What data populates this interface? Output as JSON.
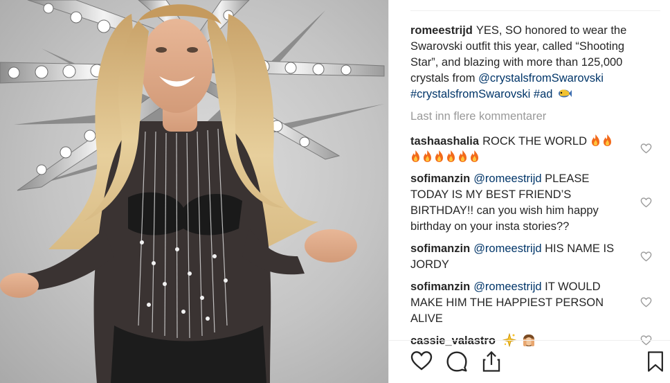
{
  "post": {
    "author": "romeestrijd",
    "caption_parts": [
      {
        "type": "text",
        "value": "YES, SO honored to wear the Swarovski outfit this year, called “Shooting Star”, and blazing with more than 125,000 crystals from "
      },
      {
        "type": "mention",
        "value": "@crystalsfromSwarovski"
      },
      {
        "type": "text",
        "value": " "
      },
      {
        "type": "tag",
        "value": "#crystalsfromSwarovski"
      },
      {
        "type": "text",
        "value": " "
      },
      {
        "type": "tag",
        "value": "#ad"
      }
    ],
    "load_more_label": "Last inn flere kommentarer"
  },
  "comments": [
    {
      "user": "tashaashalia",
      "mention": "",
      "text": "ROCK THE WORLD",
      "fire_count_inline": 2,
      "fire_count_line2": 6
    },
    {
      "user": "sofimanzin",
      "mention": "@romeestrijd",
      "text": "PLEASE TODAY IS MY BEST FRIEND’S BIRTHDAY!! can you wish him happy birthday on your insta stories??"
    },
    {
      "user": "sofimanzin",
      "mention": "@romeestrijd",
      "text": "HIS NAME IS JORDY"
    },
    {
      "user": "sofimanzin",
      "mention": "@romeestrijd",
      "text": "IT WOULD MAKE HIM THE HAPPIEST PERSON ALIVE"
    },
    {
      "user": "cassie_valastro",
      "mention": "",
      "text": ""
    }
  ],
  "icons": {
    "comment_like": "heart-outline-icon",
    "action_like": "heart-icon",
    "action_comment": "speech-bubble-icon",
    "action_share": "share-icon",
    "action_save": "bookmark-icon",
    "caption_emoji": "fish-emoji",
    "cassie_emoji_1": "sparkle-emoji",
    "cassie_emoji_2": "face-with-hands-emoji"
  },
  "colors": {
    "link": "#003569",
    "muted": "#999999",
    "text": "#262626",
    "divider": "#efefef"
  }
}
